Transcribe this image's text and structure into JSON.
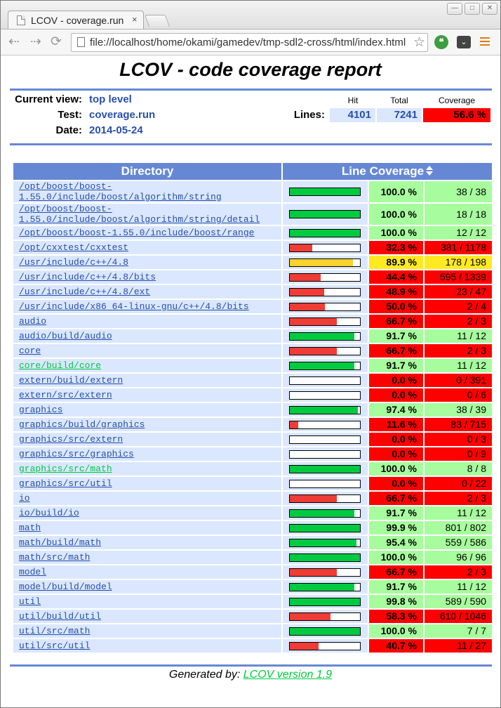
{
  "browser": {
    "tab_title": "LCOV - coverage.run",
    "tab_close": "×",
    "url": "file://localhost/home/okami/gamedev/tmp-sdl2-cross/html/index.html"
  },
  "report": {
    "title": "LCOV - code coverage report",
    "current_view_label": "Current view:",
    "current_view_value": "top level",
    "test_label": "Test:",
    "test_value": "coverage.run",
    "date_label": "Date:",
    "date_value": "2014-05-24",
    "col_hit": "Hit",
    "col_total": "Total",
    "col_coverage": "Coverage",
    "lines_label": "Lines:",
    "lines_hit": "4101",
    "lines_total": "7241",
    "lines_coverage": "56.6 %",
    "table_header_directory": "Directory",
    "table_header_line_coverage": "Line Coverage",
    "footer_prefix": "Generated by:",
    "footer_link": "LCOV version 1.9"
  },
  "colors": {
    "accent": "#6688d4",
    "row_bg": "#dae7fe",
    "high": "#a7fc9d",
    "medium": "#ffea20",
    "low": "#ff0000",
    "bar_high": "#00cb40",
    "bar_medium": "#f9d32c",
    "bar_low": "#ef3c36",
    "link": "#284fa8",
    "link_visited": "#00cb40"
  },
  "rows": [
    {
      "dir": "/opt/boost/boost-1.55.0/include/boost/algorithm/string",
      "dir_lines": [
        "/opt/boost/boost-",
        "1.55.0/include/boost/algorithm/string"
      ],
      "coverage": 1.0,
      "pct": "100.0 %",
      "hits": "38 / 38",
      "level": "high"
    },
    {
      "dir": "/opt/boost/boost-1.55.0/include/boost/algorithm/string/detail",
      "dir_lines": [
        "/opt/boost/boost-",
        "1.55.0/include/boost/algorithm/string/detail"
      ],
      "coverage": 1.0,
      "pct": "100.0 %",
      "hits": "18 / 18",
      "level": "high"
    },
    {
      "dir": "/opt/boost/boost-1.55.0/include/boost/range",
      "coverage": 1.0,
      "pct": "100.0 %",
      "hits": "12 / 12",
      "level": "high"
    },
    {
      "dir": "/opt/cxxtest/cxxtest",
      "coverage": 0.323,
      "pct": "32.3 %",
      "hits": "381 / 1178",
      "level": "low"
    },
    {
      "dir": "/usr/include/c++/4.8",
      "coverage": 0.899,
      "pct": "89.9 %",
      "hits": "178 / 198",
      "level": "medium"
    },
    {
      "dir": "/usr/include/c++/4.8/bits",
      "coverage": 0.444,
      "pct": "44.4 %",
      "hits": "595 / 1339",
      "level": "low"
    },
    {
      "dir": "/usr/include/c++/4.8/ext",
      "coverage": 0.489,
      "pct": "48.9 %",
      "hits": "23 / 47",
      "level": "low"
    },
    {
      "dir": "/usr/include/x86_64-linux-gnu/c++/4.8/bits",
      "coverage": 0.5,
      "pct": "50.0 %",
      "hits": "2 / 4",
      "level": "low"
    },
    {
      "dir": "audio",
      "coverage": 0.667,
      "pct": "66.7 %",
      "hits": "2 / 3",
      "level": "low"
    },
    {
      "dir": "audio/build/audio",
      "coverage": 0.917,
      "pct": "91.7 %",
      "hits": "11 / 12",
      "level": "high"
    },
    {
      "dir": "core",
      "coverage": 0.667,
      "pct": "66.7 %",
      "hits": "2 / 3",
      "level": "low"
    },
    {
      "dir": "core/build/core",
      "coverage": 0.917,
      "pct": "91.7 %",
      "hits": "11 / 12",
      "level": "high",
      "visited": true
    },
    {
      "dir": "extern/build/extern",
      "coverage": 0.0,
      "pct": "0.0 %",
      "hits": "0 / 391",
      "level": "low"
    },
    {
      "dir": "extern/src/extern",
      "coverage": 0.0,
      "pct": "0.0 %",
      "hits": "0 / 6",
      "level": "low"
    },
    {
      "dir": "graphics",
      "coverage": 0.974,
      "pct": "97.4 %",
      "hits": "38 / 39",
      "level": "high"
    },
    {
      "dir": "graphics/build/graphics",
      "coverage": 0.116,
      "pct": "11.6 %",
      "hits": "83 / 715",
      "level": "low"
    },
    {
      "dir": "graphics/src/extern",
      "coverage": 0.0,
      "pct": "0.0 %",
      "hits": "0 / 3",
      "level": "low"
    },
    {
      "dir": "graphics/src/graphics",
      "coverage": 0.0,
      "pct": "0.0 %",
      "hits": "0 / 9",
      "level": "low"
    },
    {
      "dir": "graphics/src/math",
      "coverage": 1.0,
      "pct": "100.0 %",
      "hits": "8 / 8",
      "level": "high",
      "visited": true
    },
    {
      "dir": "graphics/src/util",
      "coverage": 0.0,
      "pct": "0.0 %",
      "hits": "0 / 22",
      "level": "low"
    },
    {
      "dir": "io",
      "coverage": 0.667,
      "pct": "66.7 %",
      "hits": "2 / 3",
      "level": "low"
    },
    {
      "dir": "io/build/io",
      "coverage": 0.917,
      "pct": "91.7 %",
      "hits": "11 / 12",
      "level": "high"
    },
    {
      "dir": "math",
      "coverage": 0.999,
      "pct": "99.9 %",
      "hits": "801 / 802",
      "level": "high"
    },
    {
      "dir": "math/build/math",
      "coverage": 0.954,
      "pct": "95.4 %",
      "hits": "559 / 586",
      "level": "high"
    },
    {
      "dir": "math/src/math",
      "coverage": 1.0,
      "pct": "100.0 %",
      "hits": "96 / 96",
      "level": "high"
    },
    {
      "dir": "model",
      "coverage": 0.667,
      "pct": "66.7 %",
      "hits": "2 / 3",
      "level": "low"
    },
    {
      "dir": "model/build/model",
      "coverage": 0.917,
      "pct": "91.7 %",
      "hits": "11 / 12",
      "level": "high"
    },
    {
      "dir": "util",
      "coverage": 0.998,
      "pct": "99.8 %",
      "hits": "589 / 590",
      "level": "high"
    },
    {
      "dir": "util/build/util",
      "coverage": 0.583,
      "pct": "58.3 %",
      "hits": "610 / 1046",
      "level": "low"
    },
    {
      "dir": "util/src/math",
      "coverage": 1.0,
      "pct": "100.0 %",
      "hits": "7 / 7",
      "level": "high"
    },
    {
      "dir": "util/src/util",
      "coverage": 0.407,
      "pct": "40.7 %",
      "hits": "11 / 27",
      "level": "low"
    }
  ]
}
